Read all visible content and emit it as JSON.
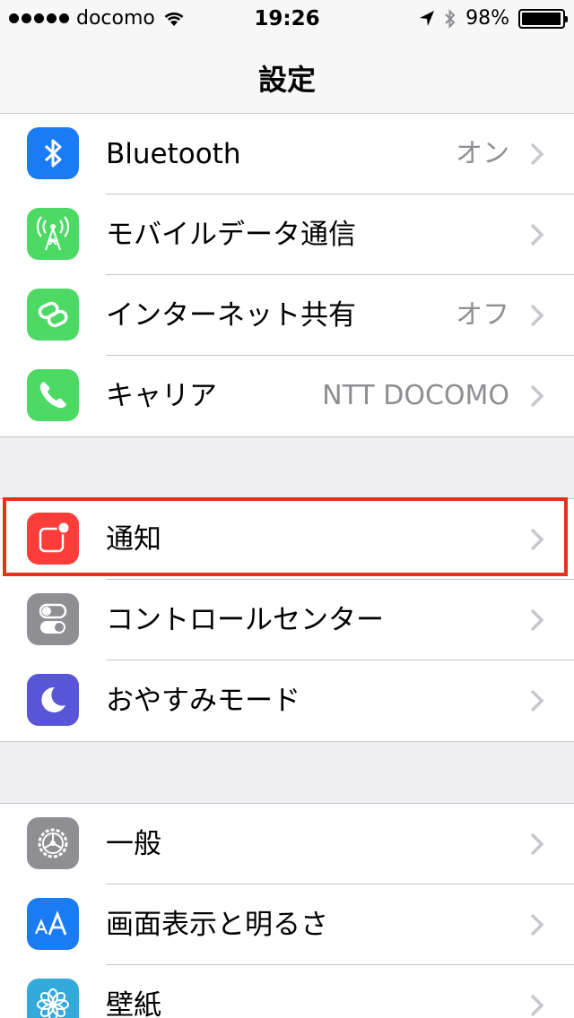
{
  "status_bar": {
    "carrier": "docomo",
    "time": "19:26",
    "battery": "98%",
    "battery_level": 0.98
  },
  "nav": {
    "title": "設定"
  },
  "groups": [
    {
      "items": [
        {
          "label": "Bluetooth",
          "value": "オン",
          "icon": "bluetooth-icon",
          "icon_color": "#1a7cf5"
        },
        {
          "label": "モバイルデータ通信",
          "value": "",
          "icon": "cellular-antenna-icon",
          "icon_color": "#4cd964"
        },
        {
          "label": "インターネット共有",
          "value": "オフ",
          "icon": "hotspot-link-icon",
          "icon_color": "#4cd964"
        },
        {
          "label": "キャリア",
          "value": "NTT DOCOMO",
          "icon": "phone-icon",
          "icon_color": "#4cd964"
        }
      ]
    },
    {
      "items": [
        {
          "label": "通知",
          "value": "",
          "icon": "notification-icon",
          "icon_color": "#fc3d39"
        },
        {
          "label": "コントロールセンター",
          "value": "",
          "icon": "control-center-icon",
          "icon_color": "#8e8e93"
        },
        {
          "label": "おやすみモード",
          "value": "",
          "icon": "moon-icon",
          "icon_color": "#5856d6"
        }
      ]
    },
    {
      "items": [
        {
          "label": "一般",
          "value": "",
          "icon": "gear-icon",
          "icon_color": "#8e8e93"
        },
        {
          "label": "画面表示と明るさ",
          "value": "",
          "icon": "text-size-icon",
          "icon_color": "#1a7cf5"
        },
        {
          "label": "壁紙",
          "value": "",
          "icon": "wallpaper-flower-icon",
          "icon_color": "#34aadc"
        }
      ]
    }
  ],
  "highlight_color": "#e8311a"
}
